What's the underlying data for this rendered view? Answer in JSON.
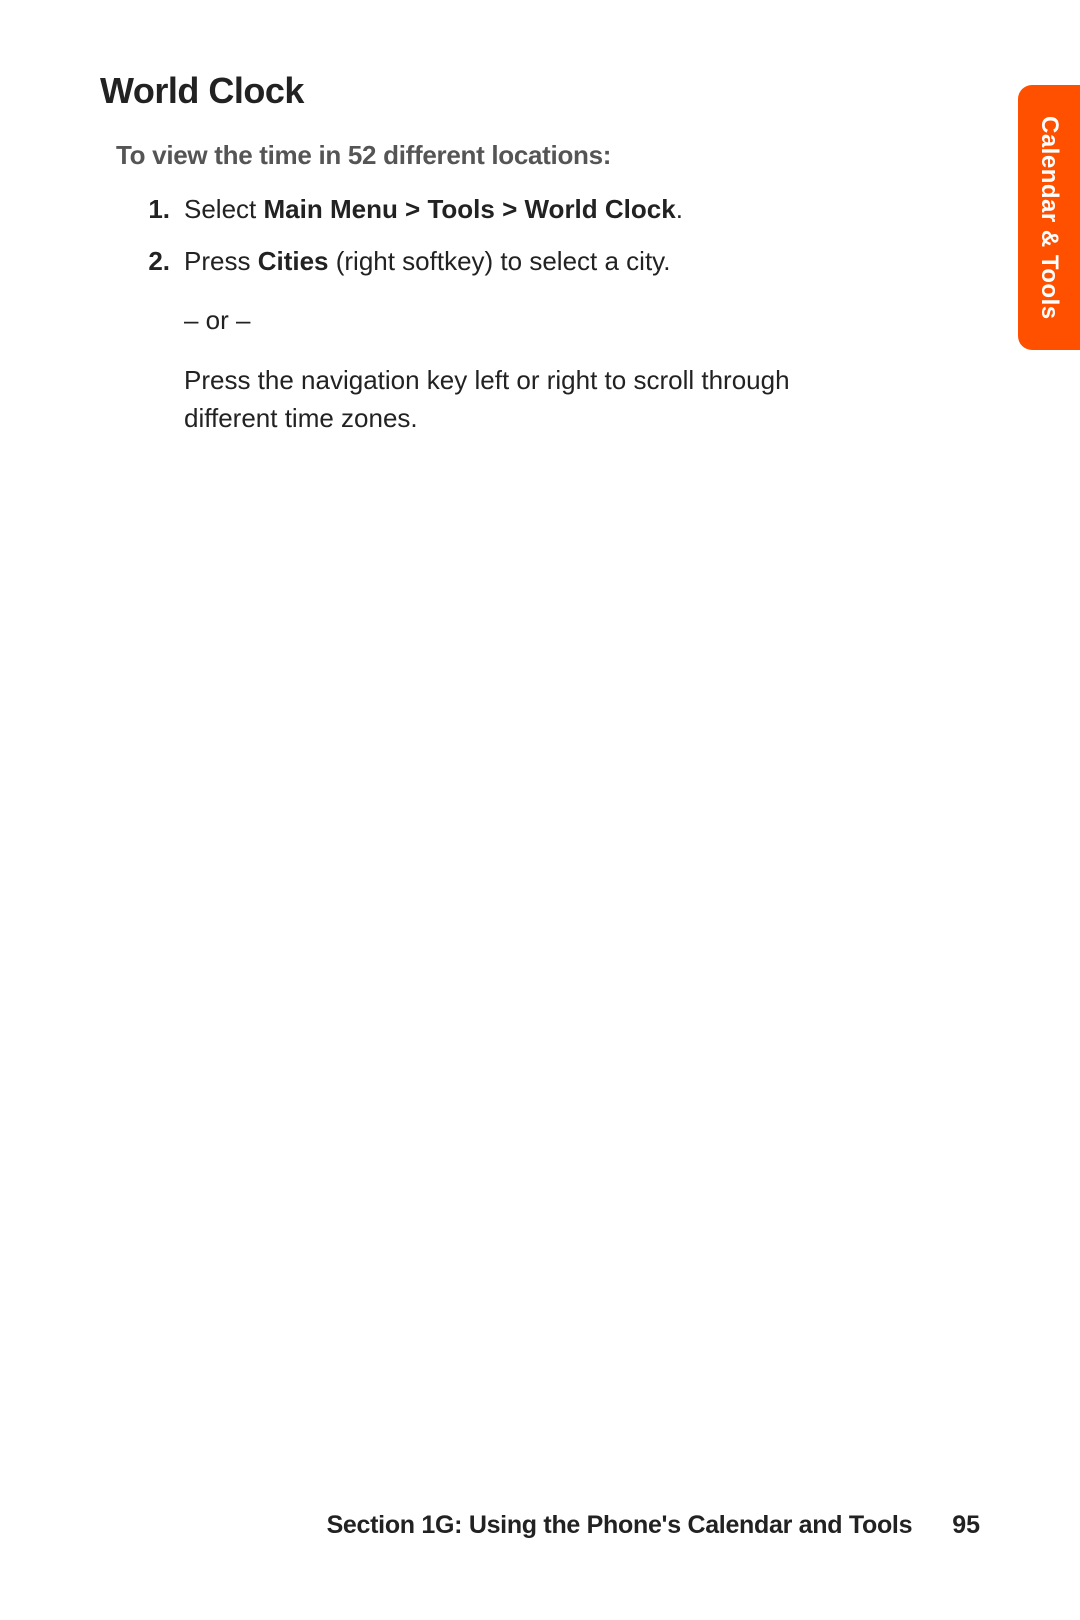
{
  "sideTab": "Calendar & Tools",
  "heading": "World Clock",
  "intro": "To view the time in 52 different locations:",
  "steps": {
    "one": {
      "num": "1.",
      "prefix": "Select ",
      "bold": "Main Menu > Tools > World Clock",
      "suffix": "."
    },
    "two": {
      "num": "2.",
      "prefix": "Press ",
      "bold": "Cities",
      "suffix": " (right softkey) to select a city.",
      "or": "– or –",
      "alt": "Press the navigation key left or right to scroll through different time zones."
    }
  },
  "footer": {
    "section": "Section 1G: Using the Phone's Calendar and Tools",
    "page": "95"
  }
}
